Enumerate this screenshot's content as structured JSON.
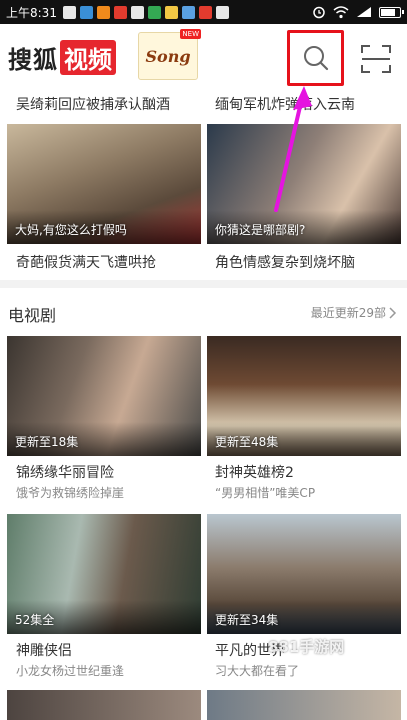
{
  "status_bar": {
    "time": "上午8:31"
  },
  "header": {
    "logo_part1": "搜狐",
    "logo_part2": "视频",
    "promo_text": "Song",
    "promo_badge": "NEW"
  },
  "top_items": [
    {
      "caption": "吴绮莉回应被捕承认酗酒"
    },
    {
      "caption": "缅甸军机炸弹落入云南"
    }
  ],
  "grid1": [
    {
      "overlay": "大妈,有您这么打假吗",
      "caption": "奇葩假货满天飞遭哄抢"
    },
    {
      "overlay": "你猜这是哪部剧?",
      "caption": "角色情感复杂到烧坏脑"
    }
  ],
  "tv_section": {
    "title": "电视剧",
    "more": "最近更新29部",
    "items": [
      {
        "badge": "更新至18集",
        "title": "锦绣缘华丽冒险",
        "subtitle": "饿爷为救锦绣险掉崖"
      },
      {
        "badge": "更新至48集",
        "title": "封神英雄榜2",
        "subtitle": "“男男相惜”唯美CP"
      },
      {
        "badge": "52集全",
        "title": "神雕侠侣",
        "subtitle": "小龙女杨过世纪重逢"
      },
      {
        "badge": "更新至34集",
        "title": "平凡的世界",
        "subtitle": "习大大都在看了"
      }
    ]
  },
  "watermark": "881手游网"
}
